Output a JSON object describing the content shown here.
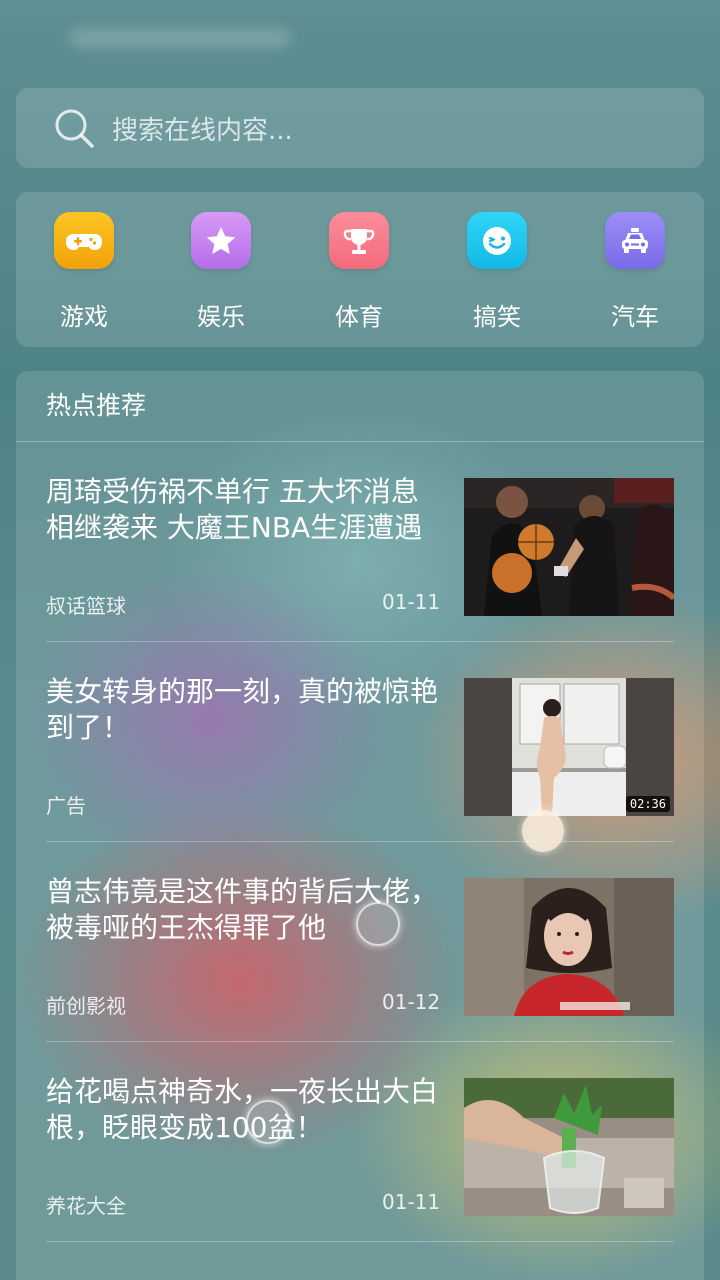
{
  "search": {
    "placeholder": "搜索在线内容..."
  },
  "categories": [
    {
      "label": "游戏",
      "icon": "gamepad-icon",
      "color": "#f5b014"
    },
    {
      "label": "娱乐",
      "icon": "star-icon",
      "color": "#c784f0"
    },
    {
      "label": "体育",
      "icon": "trophy-icon",
      "color": "#f87c8c"
    },
    {
      "label": "搞笑",
      "icon": "smiley-icon",
      "color": "#1fc7ef"
    },
    {
      "label": "汽车",
      "icon": "car-icon",
      "color": "#8a7cf0"
    }
  ],
  "feed": {
    "header": "热点推荐",
    "items": [
      {
        "title": "周琦受伤祸不单行 五大坏消息相继袭来 大魔王NBA生涯遭遇",
        "source": "叔话篮球",
        "date": "01-11",
        "thumbnail": "basketball-players-image"
      },
      {
        "title": "美女转身的那一刻，真的被惊艳到了！",
        "source": "广告",
        "date": "",
        "thumbnail": "kitchen-woman-video",
        "duration": "02:36"
      },
      {
        "title": "曾志伟竟是这件事的背后大佬，被毒哑的王杰得罪了他",
        "source": "前创影视",
        "date": "01-12",
        "thumbnail": "costume-drama-woman-image"
      },
      {
        "title": "给花喝点神奇水，一夜长出大白根，眨眼变成100盆！",
        "source": "养花大全",
        "date": "01-11",
        "thumbnail": "plant-cutting-jar-image"
      }
    ]
  }
}
